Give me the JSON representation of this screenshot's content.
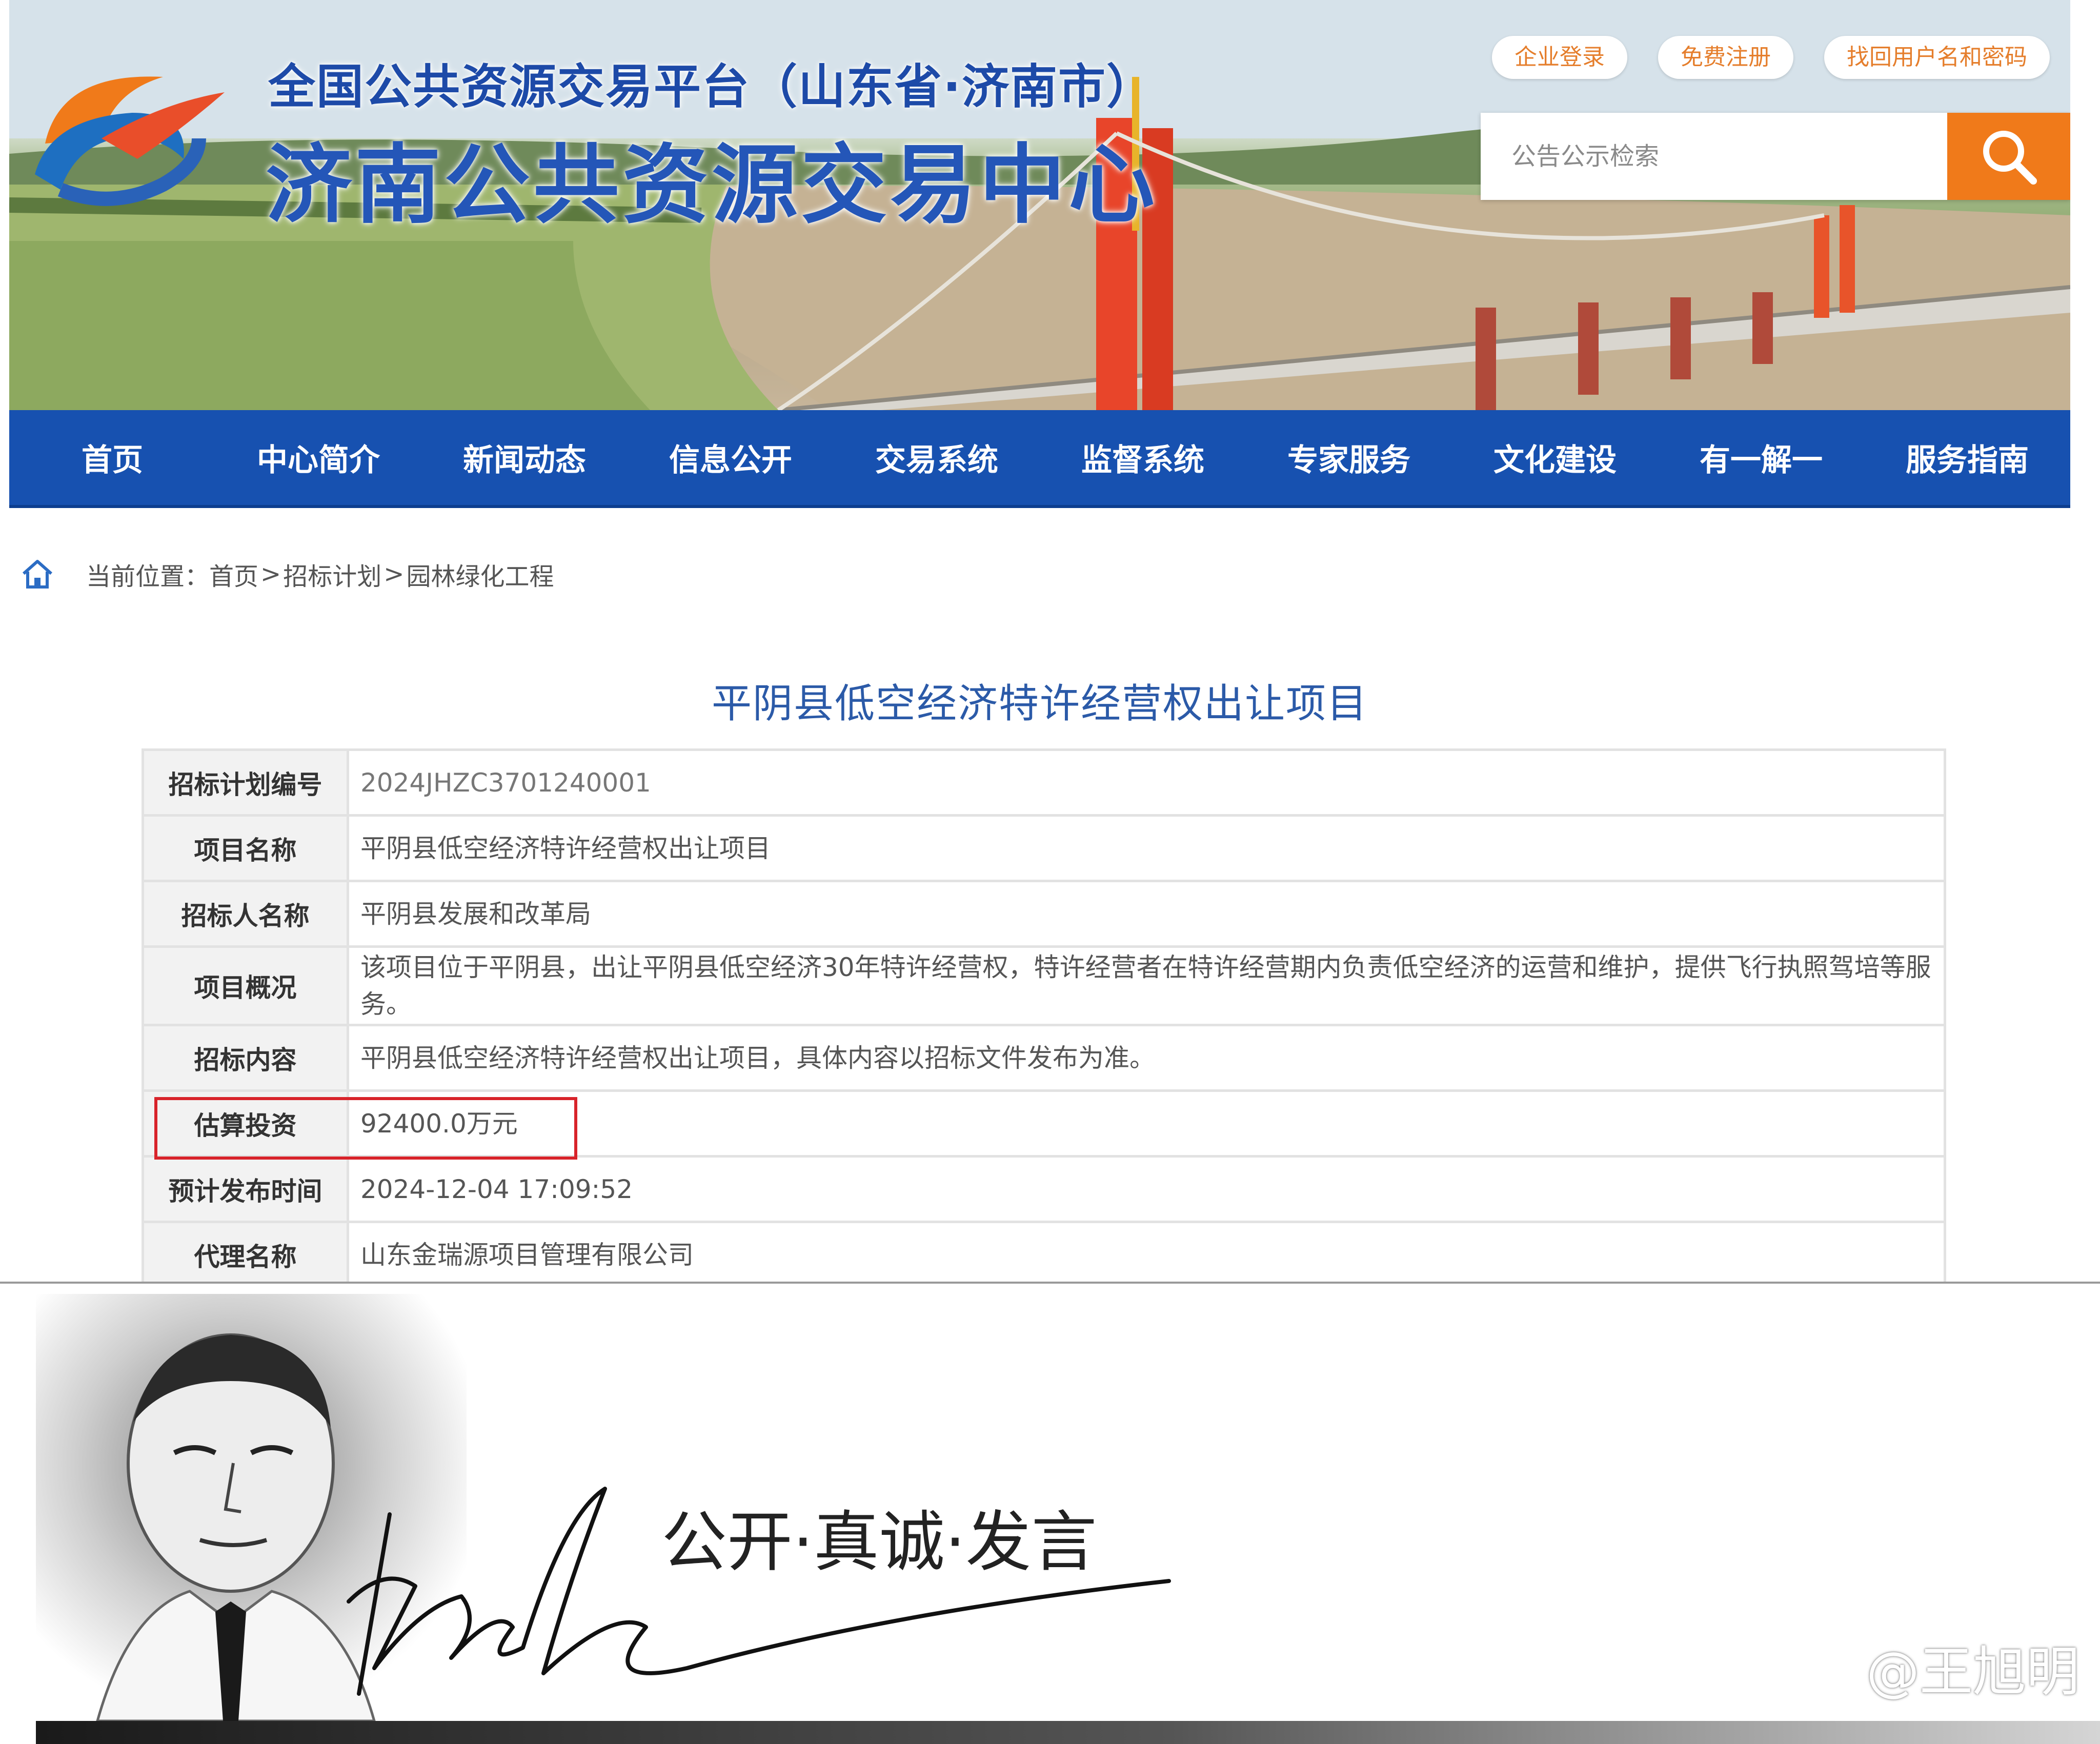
{
  "header": {
    "platform_title": "全国公共资源交易平台（山东省·济南市）",
    "center_title": "济南公共资源交易中心",
    "top_links": [
      "企业登录",
      "免费注册",
      "找回用户名和密码"
    ],
    "search_placeholder": "公告公示检索"
  },
  "nav": {
    "items": [
      "首页",
      "中心简介",
      "新闻动态",
      "信息公开",
      "交易系统",
      "监督系统",
      "专家服务",
      "文化建设",
      "有一解一",
      "服务指南"
    ]
  },
  "breadcrumb": {
    "prefix": "当前位置：",
    "items": [
      "首页",
      "招标计划",
      "园林绿化工程"
    ],
    "separator": ">"
  },
  "page": {
    "heading": "平阴县低空经济特许经营权出让项目"
  },
  "details": [
    {
      "label": "招标计划编号",
      "value": "2024JHZC3701240001"
    },
    {
      "label": "项目名称",
      "value": "平阴县低空经济特许经营权出让项目"
    },
    {
      "label": "招标人名称",
      "value": "平阴县发展和改革局"
    },
    {
      "label": "项目概况",
      "value": "该项目位于平阴县，出让平阴县低空经济30年特许经营权，特许经营者在特许经营期内负责低空经济的运营和维护，提供飞行执照驾培等服务。"
    },
    {
      "label": "招标内容",
      "value": "平阴县低空经济特许经营权出让项目，具体内容以招标文件发布为准。"
    },
    {
      "label": "估算投资",
      "value": "92400.0万元"
    },
    {
      "label": "预计发布时间",
      "value": "2024-12-04 17:09:52"
    },
    {
      "label": "代理名称",
      "value": "山东金瑞源项目管理有限公司"
    }
  ],
  "overlay": {
    "slogan": "公开·真诚·发言",
    "watermark": "@王旭明"
  },
  "colors": {
    "nav_blue": "#1751b0",
    "search_orange": "#f07a1a",
    "highlight_red": "#d8232a",
    "title_blue": "#2456b8"
  }
}
